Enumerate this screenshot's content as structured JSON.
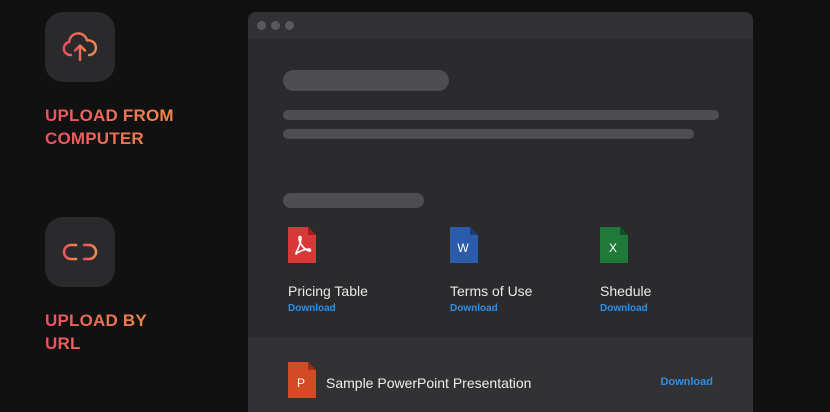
{
  "features": [
    {
      "label_line1": "UPLOAD FROM",
      "label_line2": "COMPUTER",
      "icon": "cloud-upload-icon"
    },
    {
      "label_line1": "UPLOAD BY",
      "label_line2": "URL",
      "icon": "link-icon"
    }
  ],
  "files": [
    {
      "name": "Pricing Table",
      "download": "Download",
      "icon": "pdf-file-icon",
      "color": "#d93838"
    },
    {
      "name": "Terms of Use",
      "download": "Download",
      "icon": "word-file-icon",
      "color": "#2b5bab"
    },
    {
      "name": "Shedule",
      "download": "Download",
      "icon": "excel-file-icon",
      "color": "#1f7a3a"
    }
  ],
  "featured_file": {
    "name": "Sample PowerPoint Presentation",
    "download": "Download",
    "icon": "powerpoint-file-icon",
    "color": "#d24a26"
  },
  "colors": {
    "accent_start": "#ee4f62",
    "accent_end": "#f08a4a",
    "link": "#2f8ee6"
  }
}
